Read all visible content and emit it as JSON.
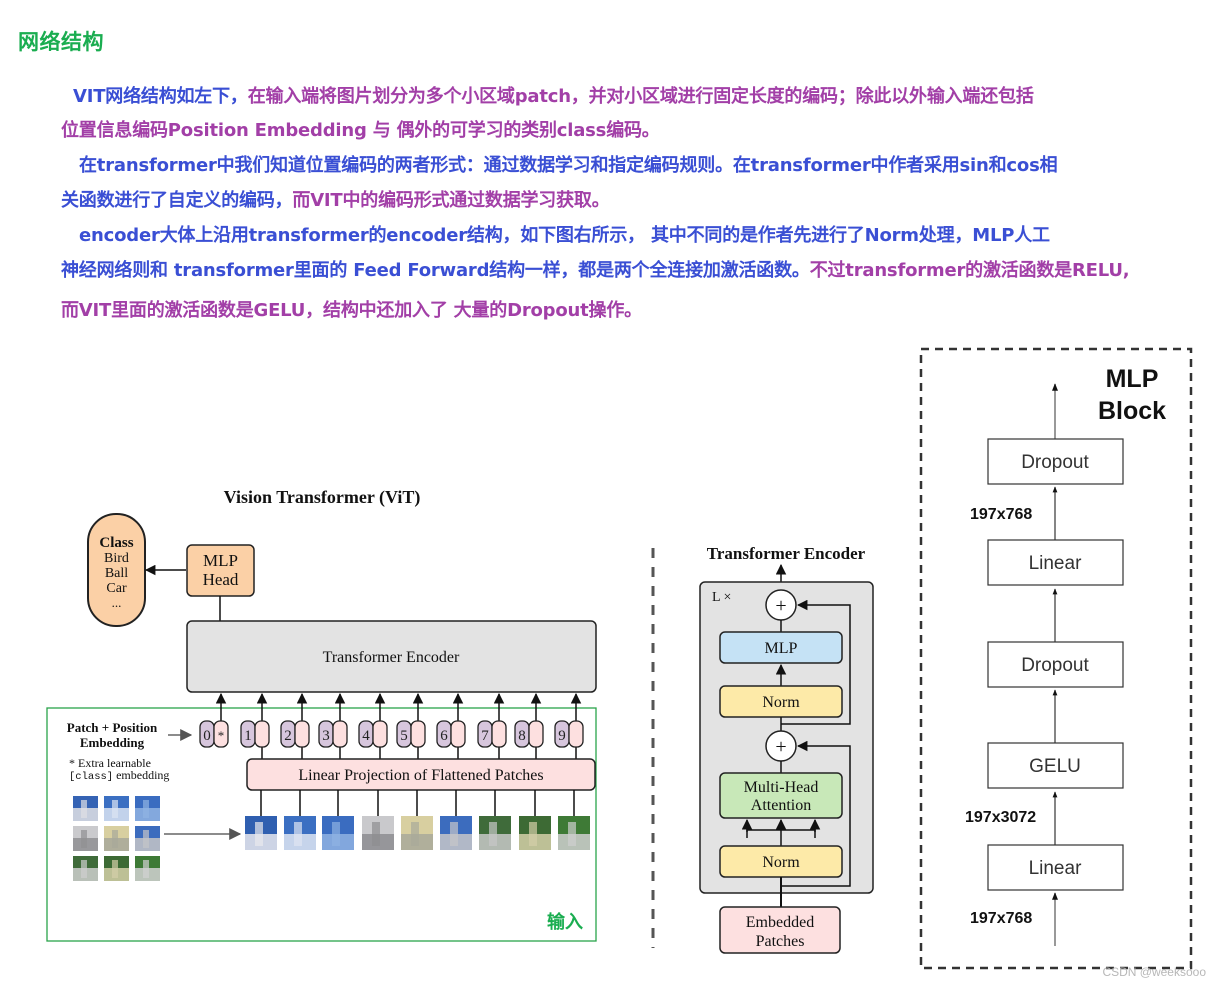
{
  "heading": "网络结构",
  "paragraphs": [
    {
      "segments": [
        {
          "text": "VIT网络结构如左下，",
          "color": "blue"
        },
        {
          "text": "在输入端将图片划分为多个小区域patch，并对小区域进行固定长度的编码；除此以外输入端还包括",
          "color": "purple"
        }
      ]
    },
    {
      "segments": [
        {
          "text": "位置信息编码Position Embedding 与 偶外的可学习的类别class编码。",
          "color": "purple"
        }
      ]
    },
    {
      "segments": [
        {
          "text": "在transformer中我们知道位置编码的两者形式：通过数据学习和指定编码规则。在transformer中作者采用sin和cos相",
          "color": "blue"
        }
      ]
    },
    {
      "segments": [
        {
          "text": "关函数进行了自定义的编码，",
          "color": "blue"
        },
        {
          "text": "而VIT中的编码形式通过数据学习获取。",
          "color": "purple"
        }
      ]
    },
    {
      "segments": [
        {
          "text": "encoder大体上沿用transformer的encoder结构，如下图右所示， 其中不同的是作者先进行了Norm处理，MLP人工",
          "color": "blue"
        }
      ]
    },
    {
      "segments": [
        {
          "text": "神经网络则和 transformer里面的 Feed Forward结构一样，都是两个全连接加激活函数。",
          "color": "blue"
        },
        {
          "text": "不过transformer的激活函数是RELU,",
          "color": "purple"
        }
      ]
    },
    {
      "segments": [
        {
          "text": "而VIT里面的激活函数是GELU，结构中还加入了 大量的Dropout操作。",
          "color": "purple"
        }
      ]
    }
  ],
  "colors": {
    "blue": "#3a4fd4",
    "purple": "#a23fa7",
    "heading": "#1aad50",
    "input_box": "#2aa34a"
  },
  "vit": {
    "title": "Vision Transformer (ViT)",
    "class_box": {
      "title": "Class",
      "items": [
        "Bird",
        "Ball",
        "Car",
        "..."
      ]
    },
    "mlp_head": [
      "MLP",
      "Head"
    ],
    "encoder_label": "Transformer Encoder",
    "patch_pos_label": [
      "Patch + Position",
      "Embedding"
    ],
    "extra_note": [
      "* Extra learnable",
      "[class] embedding"
    ],
    "tokens": [
      "0",
      "1",
      "2",
      "3",
      "4",
      "5",
      "6",
      "7",
      "8",
      "9"
    ],
    "class_token_mark": "*",
    "linear_projection": "Linear Projection of Flattened Patches",
    "input_label": "输入"
  },
  "encoder": {
    "title": "Transformer Encoder",
    "repeat": "L ×",
    "plus": "+",
    "mlp": "MLP",
    "norm": "Norm",
    "attention": [
      "Multi-Head",
      "Attention"
    ],
    "embedded": [
      "Embedded",
      "Patches"
    ]
  },
  "mlp_block": {
    "title": [
      "MLP",
      "Block"
    ],
    "layers": [
      "Dropout",
      "Linear",
      "Dropout",
      "GELU",
      "Linear"
    ],
    "dims": [
      "197x768",
      "197x3072",
      "197x768"
    ]
  },
  "watermark": "CSDN @weeksooo"
}
